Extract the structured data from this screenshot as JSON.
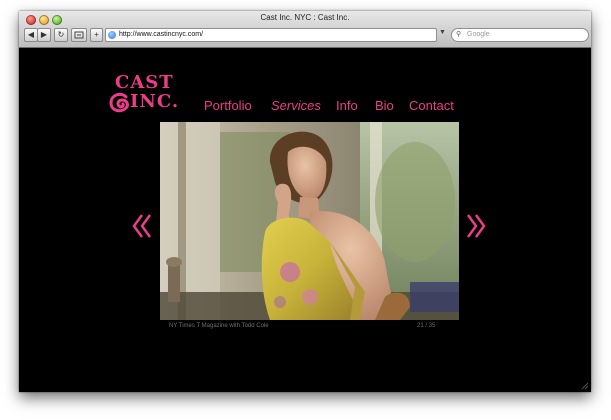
{
  "window": {
    "title": "Cast Inc. NYC : Cast Inc."
  },
  "toolbar": {
    "back_icon": "back-arrow-icon",
    "forward_icon": "forward-arrow-icon",
    "reload_icon": "reload-icon",
    "bookmark_icon": "add-bookmark-icon",
    "add_label": "+",
    "url": "http://www.castincnyc.com/",
    "search_placeholder": "Google"
  },
  "site": {
    "logo_line1": "CAST",
    "logo_line2": "INC.",
    "nav": [
      {
        "label": "Portfolio"
      },
      {
        "label": "Services"
      },
      {
        "label": "Info"
      },
      {
        "label": "Bio"
      },
      {
        "label": "Contact"
      }
    ],
    "accent_color": "#ec3c8a",
    "background_color": "#000000",
    "prev_icon": "double-chevron-left-icon",
    "next_icon": "double-chevron-right-icon"
  },
  "slideshow": {
    "caption": "NY Times T Magazine with Todd Cole",
    "counter": "21 / 35",
    "image_content": "photo"
  }
}
